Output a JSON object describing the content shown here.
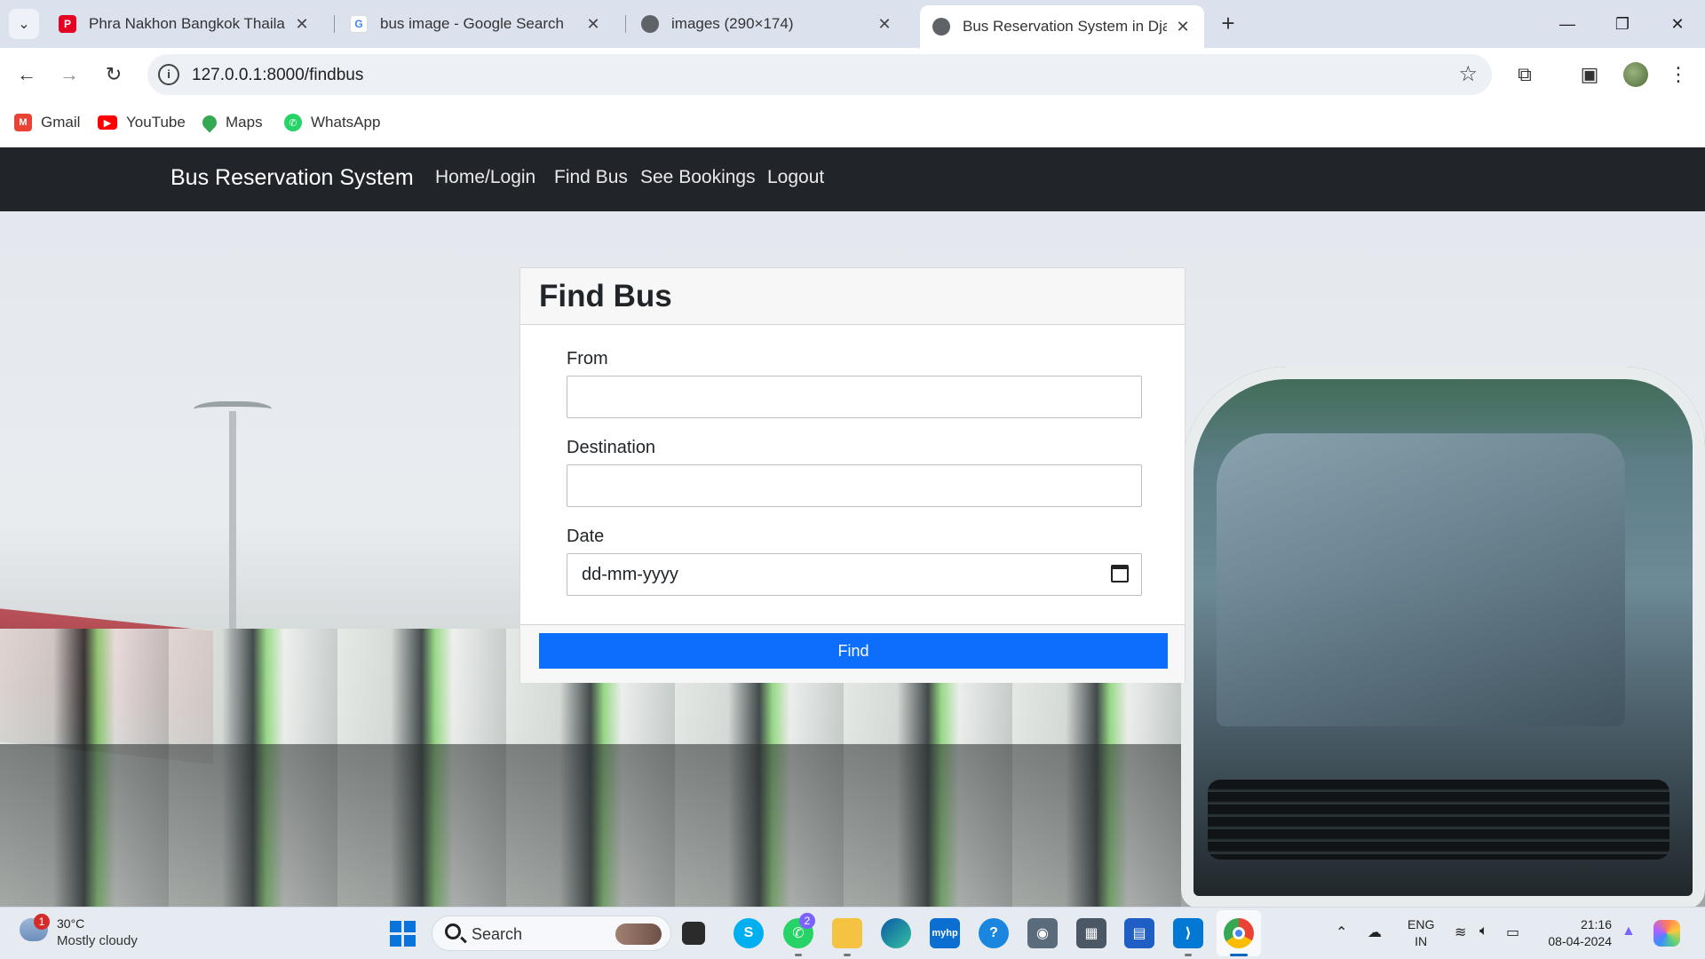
{
  "browser": {
    "tabs": [
      {
        "title": "Phra Nakhon Bangkok Thailand",
        "favicon": "pinterest-icon",
        "color": "#e60023"
      },
      {
        "title": "bus image - Google Search",
        "favicon": "google-icon",
        "color": "#4285f4"
      },
      {
        "title": "images (290×174)",
        "favicon": "globe-icon",
        "color": "#5f6368"
      },
      {
        "title": "Bus Reservation System in Djan",
        "favicon": "globe-icon",
        "color": "#5f6368"
      }
    ],
    "url": "127.0.0.1:8000/findbus",
    "bookmarks": [
      {
        "label": "Gmail",
        "icon": "gmail-icon",
        "color": "#ea4335"
      },
      {
        "label": "YouTube",
        "icon": "youtube-icon",
        "color": "#ff0000"
      },
      {
        "label": "Maps",
        "icon": "maps-icon",
        "color": "#34a853"
      },
      {
        "label": "WhatsApp",
        "icon": "whatsapp-icon",
        "color": "#25d366"
      }
    ]
  },
  "site": {
    "brand": "Bus Reservation System",
    "nav": [
      "Home/Login",
      "Find Bus",
      "See Bookings",
      "Logout"
    ]
  },
  "form": {
    "title": "Find Bus",
    "from_label": "From",
    "from_value": "",
    "destination_label": "Destination",
    "destination_value": "",
    "date_label": "Date",
    "date_placeholder": "dd-mm-yyyy",
    "submit_label": "Find",
    "accent": "#0d6efd"
  },
  "taskbar": {
    "weather_temp": "30°C",
    "weather_desc": "Mostly cloudy",
    "weather_badge": "1",
    "search_label": "Search",
    "whatsapp_badge": "2",
    "lang_line1": "ENG",
    "lang_line2": "IN",
    "time": "21:16",
    "date": "08-04-2024"
  }
}
